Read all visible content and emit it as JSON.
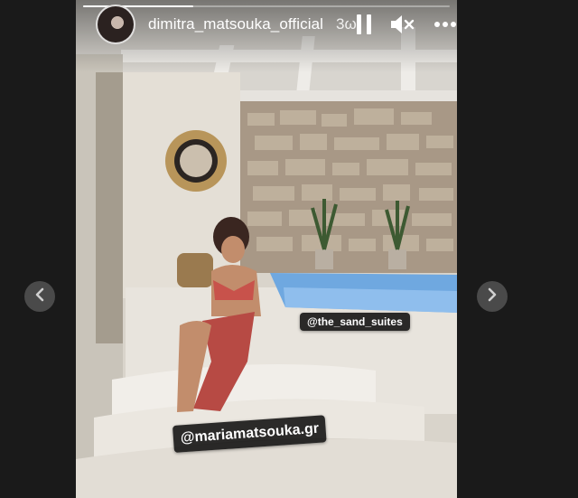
{
  "story": {
    "username": "dimitra_matsouka_official",
    "time_ago": "3ω",
    "progress": 0.3
  },
  "tags": {
    "location_tag": "@the_sand_suites",
    "mention_tag": "@mariamatsouka.gr"
  },
  "icons": {
    "pause": "pause-icon",
    "mute": "speaker-muted-icon",
    "more": "more-icon",
    "prev": "chevron-left-icon",
    "next": "chevron-right-icon"
  },
  "colors": {
    "page_background": "#1a1a1a",
    "tag_background": "#000000",
    "nav_button": "#4a4a4a",
    "pool_water": "#6fa8e0"
  }
}
